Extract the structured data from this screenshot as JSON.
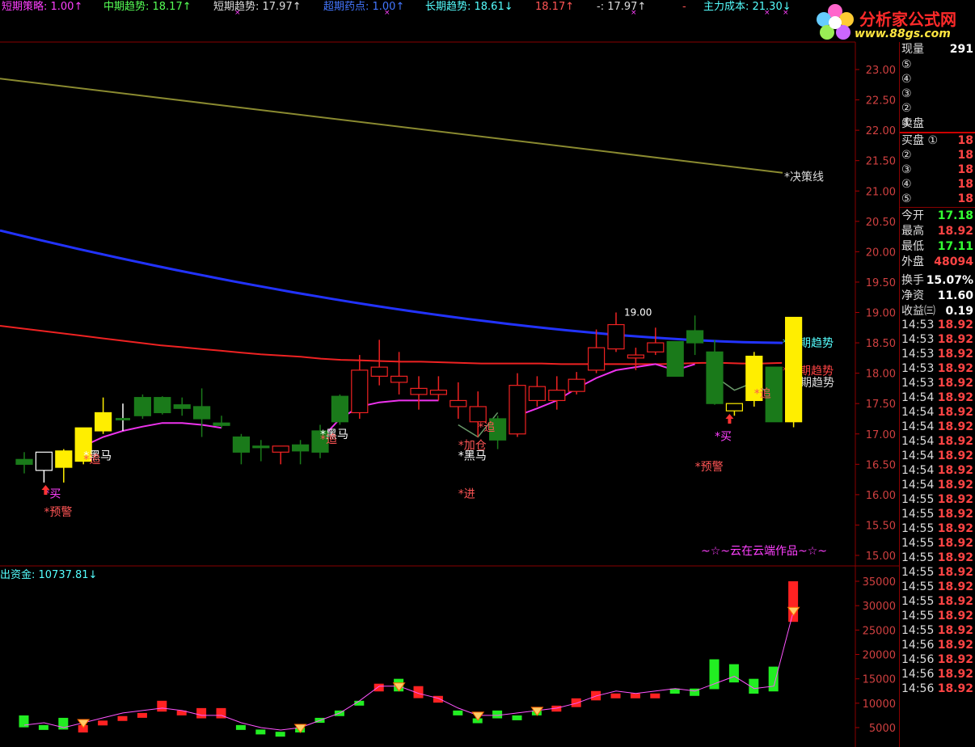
{
  "header_items": [
    {
      "text": "短期策略: 1.00↑",
      "color": "#ff40ff"
    },
    {
      "text": "中期趋势: 18.17↑",
      "color": "#55ff55"
    },
    {
      "text": "短期趋势: 17.97↑",
      "color": "#dddddd"
    },
    {
      "text": "超期药点: 1.00↑",
      "color": "#4477ff"
    },
    {
      "text": "长期趋势: 18.61↓",
      "color": "#55ffff"
    },
    {
      "text": "18.17↑",
      "color": "#ff5555"
    },
    {
      "text": "-: 17.97↑",
      "color": "#dddddd"
    },
    {
      "text": "-",
      "color": "#ff5555"
    },
    {
      "text": "主力成本: 21.30↓",
      "color": "#55ffff"
    }
  ],
  "logo": {
    "title": "分析家公式网",
    "url": "www.88gs.com"
  },
  "watermark": "~☆~云在云端作品~☆~",
  "lower_title": "出资金: 10737.81↓",
  "chart_data": {
    "type": "candlestick",
    "price_axis": {
      "ticks": [
        23.0,
        22.5,
        22.0,
        21.5,
        21.0,
        20.5,
        20.0,
        19.5,
        19.0,
        18.5,
        18.0,
        17.5,
        17.0,
        16.5,
        16.0,
        15.5,
        15.0
      ]
    },
    "volume_axis": {
      "ticks": [
        35000,
        30000,
        25000,
        20000,
        15000,
        10000,
        5000
      ]
    },
    "candles": [
      {
        "o": 16.5,
        "h": 16.7,
        "l": 16.35,
        "c": 16.58,
        "color": "green"
      },
      {
        "o": 16.4,
        "h": 16.6,
        "l": 16.2,
        "c": 16.7,
        "color": "hollow"
      },
      {
        "o": 16.45,
        "h": 16.75,
        "l": 16.2,
        "c": 16.72,
        "color": "yellow"
      },
      {
        "o": 16.55,
        "h": 17.1,
        "l": 16.5,
        "c": 17.1,
        "color": "yellow"
      },
      {
        "o": 17.05,
        "h": 17.6,
        "l": 17.0,
        "c": 17.35,
        "color": "yellow"
      },
      {
        "o": 17.25,
        "h": 17.5,
        "l": 17.05,
        "c": 17.25,
        "color": "wick"
      },
      {
        "o": 17.6,
        "h": 17.65,
        "l": 17.25,
        "c": 17.3,
        "color": "green"
      },
      {
        "o": 17.6,
        "h": 17.62,
        "l": 17.32,
        "c": 17.35,
        "color": "green"
      },
      {
        "o": 17.48,
        "h": 17.6,
        "l": 17.3,
        "c": 17.42,
        "color": "green"
      },
      {
        "o": 17.45,
        "h": 17.75,
        "l": 16.95,
        "c": 17.25,
        "color": "green"
      },
      {
        "o": 17.18,
        "h": 17.3,
        "l": 17.1,
        "c": 17.14,
        "color": "green"
      },
      {
        "o": 16.95,
        "h": 17.0,
        "l": 16.5,
        "c": 16.7,
        "color": "green"
      },
      {
        "o": 16.8,
        "h": 16.9,
        "l": 16.55,
        "c": 16.78,
        "color": "green"
      },
      {
        "o": 16.7,
        "h": 16.8,
        "l": 16.5,
        "c": 16.8,
        "color": "red"
      },
      {
        "o": 16.82,
        "h": 16.9,
        "l": 16.5,
        "c": 16.72,
        "color": "green"
      },
      {
        "o": 16.7,
        "h": 17.15,
        "l": 16.6,
        "c": 17.05,
        "color": "green"
      },
      {
        "o": 17.2,
        "h": 17.65,
        "l": 17.15,
        "c": 17.62,
        "color": "green"
      },
      {
        "o": 17.35,
        "h": 18.3,
        "l": 17.25,
        "c": 18.05,
        "color": "red"
      },
      {
        "o": 17.95,
        "h": 18.55,
        "l": 17.8,
        "c": 18.1,
        "color": "red"
      },
      {
        "o": 17.85,
        "h": 18.35,
        "l": 17.65,
        "c": 17.95,
        "color": "red"
      },
      {
        "o": 17.75,
        "h": 17.95,
        "l": 17.4,
        "c": 17.65,
        "color": "red"
      },
      {
        "o": 17.65,
        "h": 17.95,
        "l": 17.55,
        "c": 17.72,
        "color": "red"
      },
      {
        "o": 17.55,
        "h": 17.85,
        "l": 17.25,
        "c": 17.45,
        "color": "red"
      },
      {
        "o": 17.45,
        "h": 17.7,
        "l": 16.95,
        "c": 17.2,
        "color": "red"
      },
      {
        "o": 17.25,
        "h": 17.3,
        "l": 16.75,
        "c": 16.9,
        "color": "green"
      },
      {
        "o": 17.0,
        "h": 18.0,
        "l": 16.95,
        "c": 17.8,
        "color": "red"
      },
      {
        "o": 17.55,
        "h": 17.95,
        "l": 17.45,
        "c": 17.78,
        "color": "red"
      },
      {
        "o": 17.55,
        "h": 17.95,
        "l": 17.4,
        "c": 17.72,
        "color": "red"
      },
      {
        "o": 17.7,
        "h": 18.02,
        "l": 17.65,
        "c": 17.9,
        "color": "red"
      },
      {
        "o": 18.05,
        "h": 18.72,
        "l": 18.0,
        "c": 18.42,
        "color": "red"
      },
      {
        "o": 18.4,
        "h": 19.0,
        "l": 18.35,
        "c": 18.8,
        "color": "red"
      },
      {
        "o": 18.3,
        "h": 18.42,
        "l": 18.05,
        "c": 18.25,
        "color": "red"
      },
      {
        "o": 18.35,
        "h": 18.75,
        "l": 18.3,
        "c": 18.5,
        "color": "red"
      },
      {
        "o": 18.52,
        "h": 18.52,
        "l": 17.95,
        "c": 17.95,
        "color": "green"
      },
      {
        "o": 18.7,
        "h": 18.95,
        "l": 18.3,
        "c": 18.5,
        "color": "green"
      },
      {
        "o": 18.35,
        "h": 18.55,
        "l": 17.48,
        "c": 17.5,
        "color": "green"
      },
      {
        "o": 17.5,
        "h": 17.5,
        "l": 17.3,
        "c": 17.38,
        "color": "hollowyellow"
      },
      {
        "o": 17.55,
        "h": 18.35,
        "l": 17.45,
        "c": 18.28,
        "color": "yellow"
      },
      {
        "o": 18.1,
        "h": 18.1,
        "l": 17.2,
        "c": 17.2,
        "color": "green"
      },
      {
        "o": 17.2,
        "h": 18.92,
        "l": 17.11,
        "c": 18.92,
        "color": "yellow"
      }
    ],
    "decision_line": {
      "name": "决策线",
      "start": 22.85,
      "end": 21.3
    },
    "long_trend": {
      "name": "长期趋势",
      "start": 20.35,
      "end": 18.5
    },
    "mid_trend": {
      "name": "中期趋势",
      "values": [
        18.78,
        18.74,
        18.7,
        18.66,
        18.62,
        18.58,
        18.54,
        18.5,
        18.46,
        18.43,
        18.4,
        18.37,
        18.34,
        18.31,
        18.29,
        18.27,
        18.24,
        18.22,
        18.21,
        18.2,
        18.19,
        18.19,
        18.18,
        18.17,
        18.16,
        18.16,
        18.16,
        18.16,
        18.15,
        18.15,
        18.15,
        18.15,
        18.15,
        18.15,
        18.16,
        18.17,
        18.17,
        18.16,
        18.16,
        18.17
      ]
    },
    "short_trend_label": "短期趋势",
    "high_label": "19.00",
    "signals": [
      {
        "i": 1,
        "text": "*买",
        "color": "#ff40ff",
        "price": 15.95
      },
      {
        "i": 1,
        "text": "*预警",
        "color": "#ff5555",
        "price": 15.65
      },
      {
        "i": 3,
        "text": "*黑马",
        "color": "#ffffff",
        "price": 16.58
      },
      {
        "i": 3,
        "text": "*追",
        "color": "#ff5555",
        "price": 16.52
      },
      {
        "i": 15,
        "text": "*黑马",
        "color": "#ffffff",
        "price": 16.93
      },
      {
        "i": 15,
        "text": "*追",
        "color": "#ff5555",
        "price": 16.85
      },
      {
        "i": 23,
        "text": "*追",
        "color": "#ff5555",
        "price": 17.05
      },
      {
        "i": 22,
        "text": "*加仓",
        "color": "#ff5555",
        "price": 16.75
      },
      {
        "i": 22,
        "text": "*黑马",
        "color": "#ffffff",
        "price": 16.58
      },
      {
        "i": 22,
        "text": "*进",
        "color": "#ff5555",
        "price": 15.95
      },
      {
        "i": 35,
        "text": "*买",
        "color": "#ff40ff",
        "price": 16.9
      },
      {
        "i": 34,
        "text": "*预警",
        "color": "#ff5555",
        "price": 16.4
      },
      {
        "i": 37,
        "text": "*追",
        "color": "#ff5555",
        "price": 17.6
      }
    ],
    "volume": [
      {
        "v": 7500,
        "c": "green"
      },
      {
        "v": 5500,
        "c": "green"
      },
      {
        "v": 7000,
        "c": "green"
      },
      {
        "v": 4000,
        "c": "red"
      },
      {
        "v": 5500,
        "c": "red"
      },
      {
        "v": 6500,
        "c": "red"
      },
      {
        "v": 8000,
        "c": "red"
      },
      {
        "v": 10500,
        "c": "red"
      },
      {
        "v": 8500,
        "c": "red"
      },
      {
        "v": 9000,
        "c": "red"
      },
      {
        "v": 9000,
        "c": "red"
      },
      {
        "v": 5500,
        "c": "green"
      },
      {
        "v": 4500,
        "c": "green"
      },
      {
        "v": 4000,
        "c": "green"
      },
      {
        "v": 5000,
        "c": "green"
      },
      {
        "v": 7000,
        "c": "green"
      },
      {
        "v": 8500,
        "c": "green"
      },
      {
        "v": 10500,
        "c": "green"
      },
      {
        "v": 14000,
        "c": "red"
      },
      {
        "v": 15000,
        "c": "green"
      },
      {
        "v": 13500,
        "c": "red"
      },
      {
        "v": 11500,
        "c": "red"
      },
      {
        "v": 8500,
        "c": "green"
      },
      {
        "v": 6500,
        "c": "green"
      },
      {
        "v": 8500,
        "c": "green"
      },
      {
        "v": 7500,
        "c": "green"
      },
      {
        "v": 8500,
        "c": "green"
      },
      {
        "v": 9500,
        "c": "red"
      },
      {
        "v": 11000,
        "c": "red"
      },
      {
        "v": 12500,
        "c": "red"
      },
      {
        "v": 12000,
        "c": "red"
      },
      {
        "v": 12000,
        "c": "red"
      },
      {
        "v": 12000,
        "c": "red"
      },
      {
        "v": 13000,
        "c": "green"
      },
      {
        "v": 13000,
        "c": "green"
      },
      {
        "v": 19000,
        "c": "green"
      },
      {
        "v": 18000,
        "c": "green"
      },
      {
        "v": 15000,
        "c": "green"
      },
      {
        "v": 17500,
        "c": "green"
      },
      {
        "v": 35000,
        "c": "red"
      }
    ],
    "volume_line": [
      5500,
      6000,
      5000,
      6000,
      7000,
      8000,
      8500,
      9000,
      8500,
      7500,
      7500,
      6000,
      5000,
      4500,
      5000,
      6500,
      8000,
      10500,
      13500,
      13500,
      12000,
      11000,
      9000,
      7500,
      7500,
      8000,
      8500,
      9000,
      10000,
      11500,
      12500,
      12000,
      12500,
      13000,
      12500,
      14000,
      15500,
      13000,
      13500,
      29000
    ],
    "volume_markers": [
      3,
      14,
      19,
      23,
      26,
      39
    ]
  },
  "sidebar": {
    "top_label": "现量",
    "top_value": "291",
    "sell_levels": [
      "⑤",
      "④",
      "③",
      "②",
      "①"
    ],
    "sell_label": "卖盘",
    "buy_label": "买盘",
    "buy_levels": [
      "①",
      "②",
      "③",
      "④",
      "⑤"
    ],
    "buy_values": [
      "18",
      "18",
      "18",
      "18",
      "18"
    ],
    "stats": [
      {
        "label": "今开",
        "value": "17.18",
        "color": "#33ff33"
      },
      {
        "label": "最高",
        "value": "18.92",
        "color": "#ff4444"
      },
      {
        "label": "最低",
        "value": "17.11",
        "color": "#33ff33"
      },
      {
        "label": "外盘",
        "value": "48094",
        "color": "#ff4444"
      },
      {
        "label": "换手",
        "value": "15.07%",
        "color": "#ffffff"
      },
      {
        "label": "净资",
        "value": "11.60",
        "color": "#ffffff"
      },
      {
        "label": "收益㈢",
        "value": "0.19",
        "color": "#ffffff"
      }
    ],
    "ticks": [
      [
        "14:53",
        "18.92"
      ],
      [
        "14:53",
        "18.92"
      ],
      [
        "14:53",
        "18.92"
      ],
      [
        "14:53",
        "18.92"
      ],
      [
        "14:53",
        "18.92"
      ],
      [
        "14:54",
        "18.92"
      ],
      [
        "14:54",
        "18.92"
      ],
      [
        "14:54",
        "18.92"
      ],
      [
        "14:54",
        "18.92"
      ],
      [
        "14:54",
        "18.92"
      ],
      [
        "14:54",
        "18.92"
      ],
      [
        "14:54",
        "18.92"
      ],
      [
        "14:55",
        "18.92"
      ],
      [
        "14:55",
        "18.92"
      ],
      [
        "14:55",
        "18.92"
      ],
      [
        "14:55",
        "18.92"
      ],
      [
        "14:55",
        "18.92"
      ],
      [
        "14:55",
        "18.92"
      ],
      [
        "14:55",
        "18.92"
      ],
      [
        "14:55",
        "18.92"
      ],
      [
        "14:55",
        "18.92"
      ],
      [
        "14:55",
        "18.92"
      ],
      [
        "14:56",
        "18.92"
      ],
      [
        "14:56",
        "18.92"
      ],
      [
        "14:56",
        "18.92"
      ],
      [
        "14:56",
        "18.92"
      ]
    ]
  }
}
